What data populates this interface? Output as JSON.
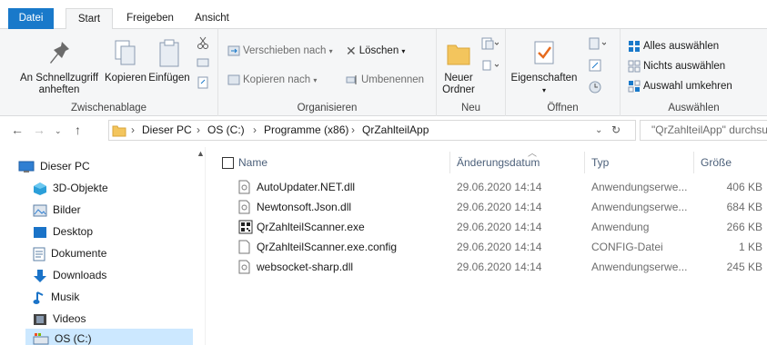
{
  "tabs": [
    "Datei",
    "Start",
    "Freigeben",
    "Ansicht"
  ],
  "ribbon": {
    "clipboard": {
      "pin_label_1": "An Schnellzugriff",
      "pin_label_2": "anheften",
      "copy_label": "Kopieren",
      "paste_label": "Einfügen",
      "group_label": "Zwischenablage"
    },
    "organize": {
      "move_label": "Verschieben nach",
      "copy_to_label": "Kopieren nach",
      "delete_label": "Löschen",
      "rename_label": "Umbenennen",
      "group_label": "Organisieren"
    },
    "new": {
      "new_folder_1": "Neuer",
      "new_folder_2": "Ordner",
      "group_label": "Neu"
    },
    "open": {
      "properties_label": "Eigenschaften",
      "group_label": "Öffnen"
    },
    "select": {
      "select_all": "Alles auswählen",
      "select_none": "Nichts auswählen",
      "invert": "Auswahl umkehren",
      "group_label": "Auswählen"
    }
  },
  "address": {
    "crumbs": [
      "Dieser PC",
      "OS (C:)",
      "Programme (x86)",
      "QrZahlteilApp"
    ],
    "search_placeholder": "\"QrZahlteilApp\" durchsuchen"
  },
  "nav": {
    "items": [
      "Dieser PC",
      "3D-Objekte",
      "Bilder",
      "Desktop",
      "Dokumente",
      "Downloads",
      "Musik",
      "Videos",
      "OS (C:)"
    ]
  },
  "columns": {
    "name": "Name",
    "date": "Änderungsdatum",
    "type": "Typ",
    "size": "Größe"
  },
  "files": [
    {
      "name": "AutoUpdater.NET.dll",
      "date": "29.06.2020 14:14",
      "type": "Anwendungserwe...",
      "size": "406 KB",
      "icon": "dll-icon"
    },
    {
      "name": "Newtonsoft.Json.dll",
      "date": "29.06.2020 14:14",
      "type": "Anwendungserwe...",
      "size": "684 KB",
      "icon": "dll-icon"
    },
    {
      "name": "QrZahlteilScanner.exe",
      "date": "29.06.2020 14:14",
      "type": "Anwendung",
      "size": "266 KB",
      "icon": "qr-exe-icon"
    },
    {
      "name": "QrZahlteilScanner.exe.config",
      "date": "29.06.2020 14:14",
      "type": "CONFIG-Datei",
      "size": "1 KB",
      "icon": "config-file-icon"
    },
    {
      "name": "websocket-sharp.dll",
      "date": "29.06.2020 14:14",
      "type": "Anwendungserwe...",
      "size": "245 KB",
      "icon": "dll-icon"
    }
  ],
  "colors": {
    "accent": "#1979ca",
    "selection": "#cce8ff",
    "folder": "#f3c55d"
  }
}
